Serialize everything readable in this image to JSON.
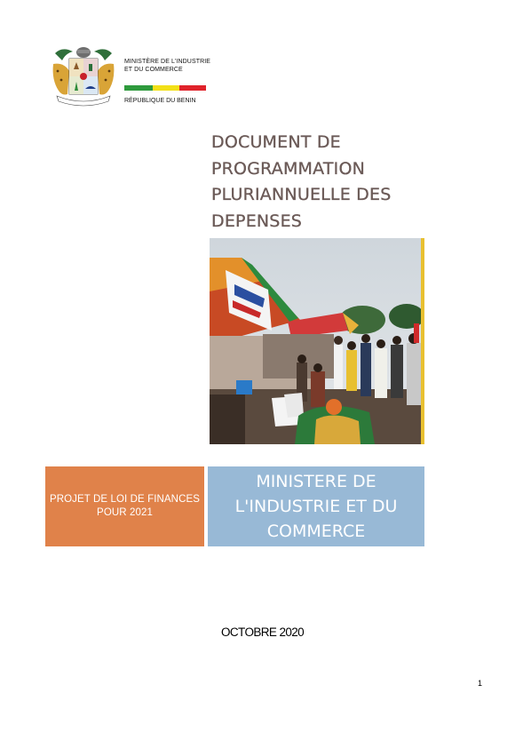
{
  "header": {
    "ministry_line1": "MINISTÈRE DE L'INDUSTRIE",
    "ministry_line2": "ET DU COMMERCE",
    "republic": "RÉPUBLIQUE DU BENIN",
    "flag_colors": [
      "#2e9a3d",
      "#f2e018",
      "#e0232b"
    ]
  },
  "title": {
    "line1": "DOCUMENT DE",
    "line2": "PROGRAMMATION",
    "line3": "PLURIANNUELLE DES",
    "line4": "DEPENSES",
    "color": "#6b5a57"
  },
  "panels": {
    "left_line1": "PROJET DE LOI DE FINANCES",
    "left_line2": "POUR 2021",
    "left_color": "#e0824a",
    "right_line1": "MINISTERE DE",
    "right_line2": "L'INDUSTRIE ET DU",
    "right_line3": "COMMERCE",
    "right_color": "#98b9d6"
  },
  "footer": {
    "date": "OCTOBRE 2020",
    "page_number": "1"
  }
}
